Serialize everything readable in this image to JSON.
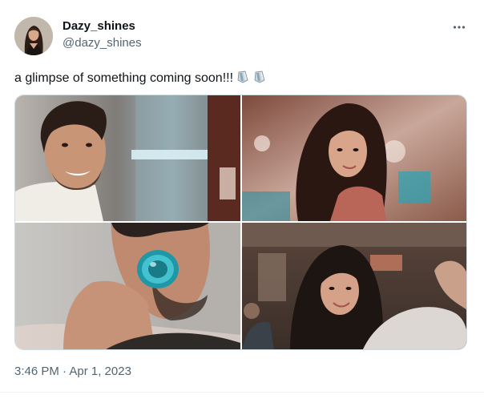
{
  "tweet": {
    "author": {
      "display_name": "Dazy_shines",
      "handle": "@dazy_shines"
    },
    "text": "a glimpse of something coming soon!!!",
    "emojis": [
      "sparkle-glass-emoji",
      "sparkle-glass-emoji"
    ],
    "timestamp": "3:46 PM · Apr 1, 2023",
    "media": [
      {
        "name": "photo-man-smiling"
      },
      {
        "name": "photo-woman-looking-back"
      },
      {
        "name": "photo-man-drinking-from-bottle"
      },
      {
        "name": "photo-woman-smiling-in-crowd"
      }
    ]
  },
  "icons": {
    "more": "more-horizontal-icon"
  },
  "colors": {
    "text_primary": "#0f1419",
    "text_secondary": "#536471",
    "border": "#cfd9de"
  }
}
